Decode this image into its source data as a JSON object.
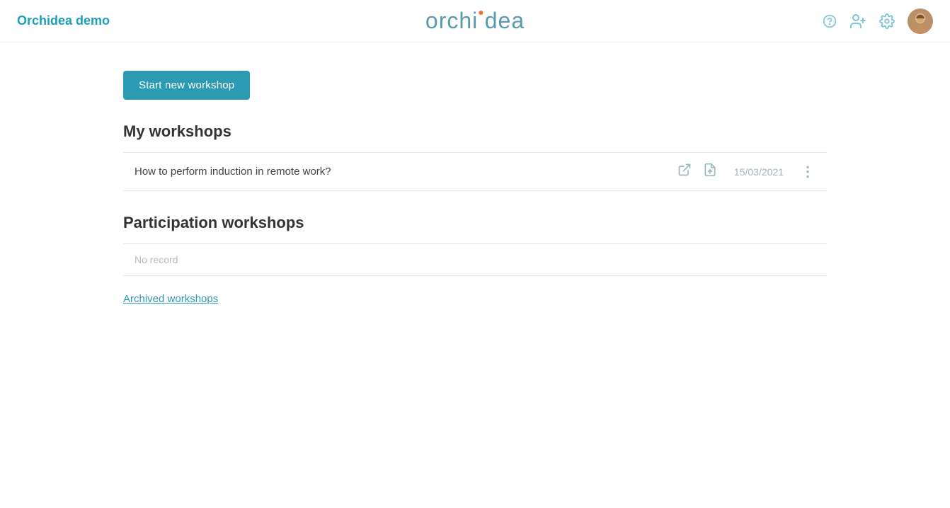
{
  "header": {
    "brand_label": "Orchidea demo",
    "logo_text_left": "orchi",
    "logo_dot": "i",
    "logo_text_right": "dea",
    "help_icon": "question-circle-icon",
    "add_user_icon": "add-user-icon",
    "settings_icon": "gear-icon",
    "avatar_alt": "User avatar"
  },
  "main": {
    "start_button_label": "Start new workshop",
    "my_workshops_title": "My workshops",
    "workshop_item": {
      "title": "How to perform induction in remote work?",
      "date": "15/03/2021"
    },
    "participation_title": "Participation workshops",
    "no_record_text": "No record",
    "archived_link_label": "Archived workshops"
  }
}
